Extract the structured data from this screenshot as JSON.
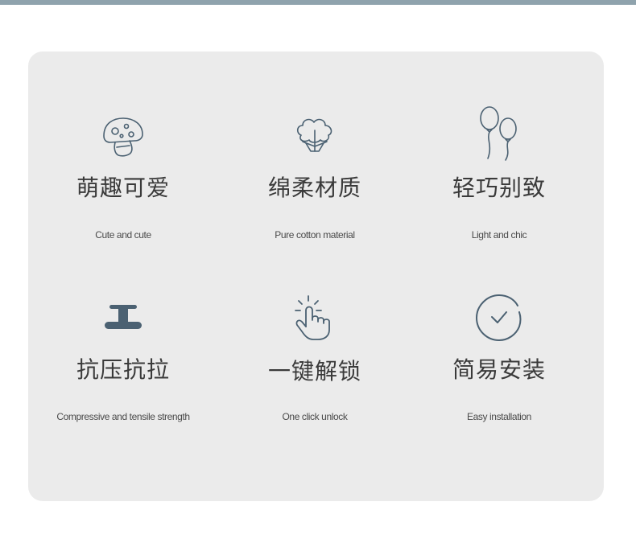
{
  "features": [
    {
      "icon": "mushroom-icon",
      "title": "萌趣可爱",
      "subtitle": "Cute and cute"
    },
    {
      "icon": "cotton-icon",
      "title": "绵柔材质",
      "subtitle": "Pure cotton material"
    },
    {
      "icon": "balloon-icon",
      "title": "轻巧别致",
      "subtitle": "Light and chic"
    },
    {
      "icon": "i-beam-icon",
      "title": "抗压抗拉",
      "subtitle": "Compressive and tensile strength"
    },
    {
      "icon": "tap-hand-icon",
      "title": "一键解锁",
      "subtitle": "One click unlock"
    },
    {
      "icon": "check-circle-icon",
      "title": "简易安装",
      "subtitle": "Easy installation"
    }
  ],
  "colors": {
    "top_bar": "#8fa3ad",
    "panel": "#ebebeb",
    "icon_stroke": "#4b6172",
    "title_text": "#3a3a3a"
  }
}
